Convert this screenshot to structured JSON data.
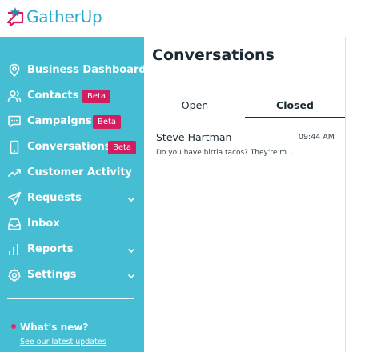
{
  "brand": {
    "name": "GatherUp",
    "accent": "#29a9c7",
    "star_color": "#1f8fb0",
    "bubble_color": "#d21d5e"
  },
  "sidebar": {
    "background": "#45bdd2",
    "items": [
      {
        "label": "Business Dashboard",
        "icon": "map-pin-icon"
      },
      {
        "label": "Contacts",
        "icon": "users-icon",
        "badge": "Beta"
      },
      {
        "label": "Campaigns",
        "icon": "chat-bubble-icon",
        "badge": "Beta"
      },
      {
        "label": "Conversations",
        "icon": "phone-icon",
        "badge": "Beta"
      },
      {
        "label": "Customer Activity",
        "icon": "trend-up-icon"
      },
      {
        "label": "Requests",
        "icon": "send-icon",
        "expandable": true
      },
      {
        "label": "Inbox",
        "icon": "inbox-icon"
      },
      {
        "label": "Reports",
        "icon": "bar-chart-icon",
        "expandable": true
      },
      {
        "label": "Settings",
        "icon": "gear-icon",
        "expandable": true
      }
    ],
    "whats_new": "What's new?",
    "latest_updates": "See our latest updates"
  },
  "main": {
    "title": "Conversations",
    "tabs": [
      {
        "label": "Open",
        "active": false
      },
      {
        "label": "Closed",
        "active": true
      }
    ],
    "conversations": [
      {
        "name": "Steve Hartman",
        "time": "09:44 AM",
        "preview": "Do you have birria tacos? They're m..."
      }
    ]
  }
}
